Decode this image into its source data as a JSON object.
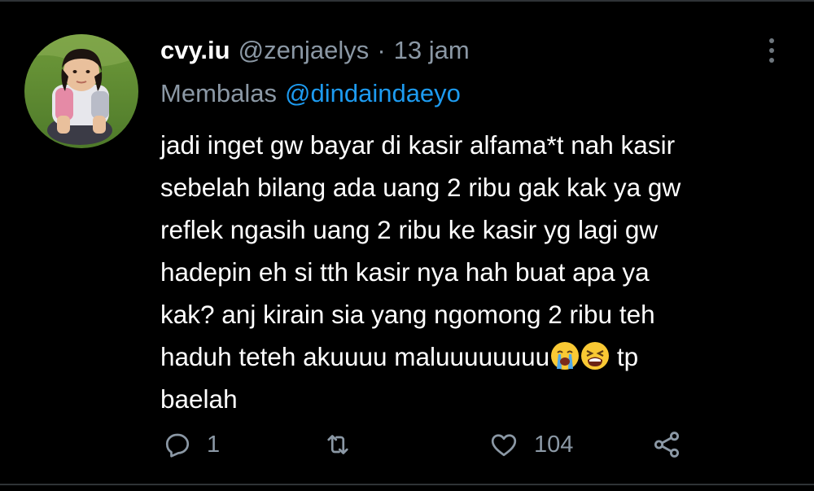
{
  "tweet": {
    "display_name": "cvy.iu",
    "handle": "@zenjaelys",
    "separator": "·",
    "time": "13 jam",
    "reply_prefix": "Membalas",
    "reply_to": "@dindaindaeyo",
    "lines": [
      "jadi inget gw bayar di kasir alfama*t nah kasir",
      "sebelah bilang ada uang 2 ribu gak kak ya gw",
      "reflek ngasih uang 2 ribu ke kasir yg lagi gw",
      "hadepin eh si tth kasir nya hah buat apa ya",
      "kak? anj kirain sia yang ngomong 2 ribu teh"
    ],
    "line6_text": "haduh teteh akuuuu maluuuuuuuu",
    "line6_emojis": [
      "loudly-crying-face-emoji",
      "tired-face-emoji"
    ],
    "line6_tail": " tp",
    "line7": "baelah"
  },
  "actions": {
    "reply_count": "1",
    "retweet_count": "",
    "like_count": "104"
  },
  "icons": {
    "reply": "reply-icon",
    "retweet": "retweet-icon",
    "like": "heart-icon",
    "share": "share-icon",
    "more": "more-vertical-icon"
  },
  "colors": {
    "background": "#000000",
    "text": "#ffffff",
    "secondary": "#8b98a5",
    "accent": "#1d9bf0",
    "icon": "#8b98a5"
  }
}
